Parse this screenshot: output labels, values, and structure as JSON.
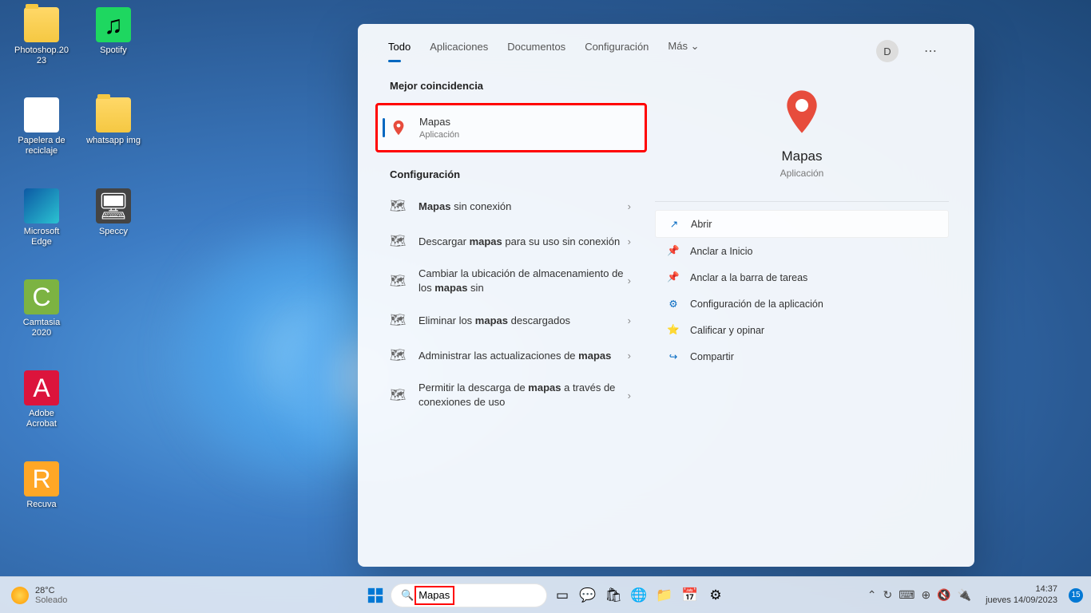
{
  "desktop": {
    "icons": [
      {
        "label": "Photoshop.2023",
        "type": "folder"
      },
      {
        "label": "Spotify",
        "type": "spotify"
      },
      {
        "label": "Papelera de reciclaje",
        "type": "recycle"
      },
      {
        "label": "whatsapp img",
        "type": "folder"
      },
      {
        "label": "Microsoft Edge",
        "type": "edge"
      },
      {
        "label": "Speccy",
        "type": "speccy"
      },
      {
        "label": "Camtasia 2020",
        "type": "camtasia"
      },
      {
        "label": "Adobe Acrobat",
        "type": "acrobat"
      },
      {
        "label": "Recuva",
        "type": "recuva"
      }
    ]
  },
  "search_panel": {
    "tabs": {
      "all": "Todo",
      "apps": "Aplicaciones",
      "docs": "Documentos",
      "config": "Configuración",
      "more": "Más"
    },
    "user_initial": "D",
    "best_match_header": "Mejor coincidencia",
    "best_match": {
      "title": "Mapas",
      "subtitle": "Aplicación"
    },
    "config_header": "Configuración",
    "config_items": [
      {
        "pre": "",
        "bold": "Mapas",
        "post": " sin conexión"
      },
      {
        "pre": "Descargar ",
        "bold": "mapas",
        "post": " para su uso sin conexión"
      },
      {
        "pre": "Cambiar la ubicación de almacenamiento de los ",
        "bold": "mapas",
        "post": " sin"
      },
      {
        "pre": "Eliminar los ",
        "bold": "mapas",
        "post": " descargados"
      },
      {
        "pre": "Administrar las actualizaciones de ",
        "bold": "mapas",
        "post": ""
      },
      {
        "pre": "Permitir la descarga de ",
        "bold": "mapas",
        "post": " a través de conexiones de uso"
      }
    ],
    "preview": {
      "title": "Mapas",
      "subtitle": "Aplicación"
    },
    "actions": [
      {
        "icon": "↗",
        "label": "Abrir"
      },
      {
        "icon": "📌",
        "label": "Anclar a Inicio"
      },
      {
        "icon": "📌",
        "label": "Anclar a la barra de tareas"
      },
      {
        "icon": "⚙",
        "label": "Configuración de la aplicación"
      },
      {
        "icon": "⭐",
        "label": "Calificar y opinar"
      },
      {
        "icon": "↪",
        "label": "Compartir"
      }
    ]
  },
  "taskbar": {
    "weather": {
      "temp": "28°C",
      "cond": "Soleado"
    },
    "search_value": "Mapas",
    "clock": {
      "time": "14:37",
      "date": "jueves 14/09/2023"
    },
    "notif_count": "15"
  }
}
